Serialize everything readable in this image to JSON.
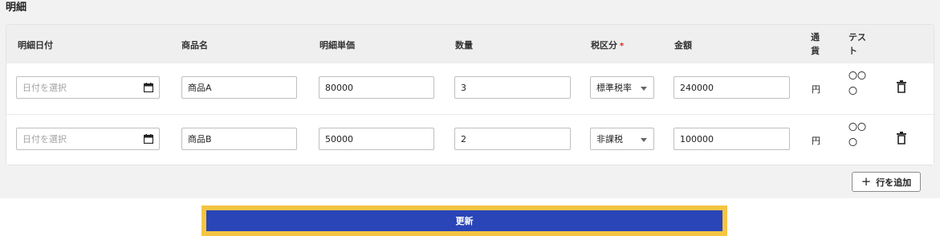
{
  "section_title": "明細",
  "headers": {
    "date": "明細日付",
    "product": "商品名",
    "unit_price": "明細単価",
    "quantity": "数量",
    "tax_category": "税区分",
    "required_mark": "*",
    "amount": "金額",
    "currency": "通貨",
    "test": "テスト"
  },
  "rows": [
    {
      "date_placeholder": "日付を選択",
      "product": "商品A",
      "unit_price": "80000",
      "quantity": "3",
      "tax_category": "標準税率",
      "amount": "240000",
      "currency": "円",
      "test": "〇〇〇"
    },
    {
      "date_placeholder": "日付を選択",
      "product": "商品B",
      "unit_price": "50000",
      "quantity": "2",
      "tax_category": "非課税",
      "amount": "100000",
      "currency": "円",
      "test": "〇〇〇"
    }
  ],
  "add_row": {
    "icon": "plus-icon",
    "label": "行を追加"
  },
  "update_button": {
    "label": "更新"
  },
  "colors": {
    "accent": "#2a45b8",
    "focus_outline": "#f4c542",
    "required": "#e02020"
  }
}
